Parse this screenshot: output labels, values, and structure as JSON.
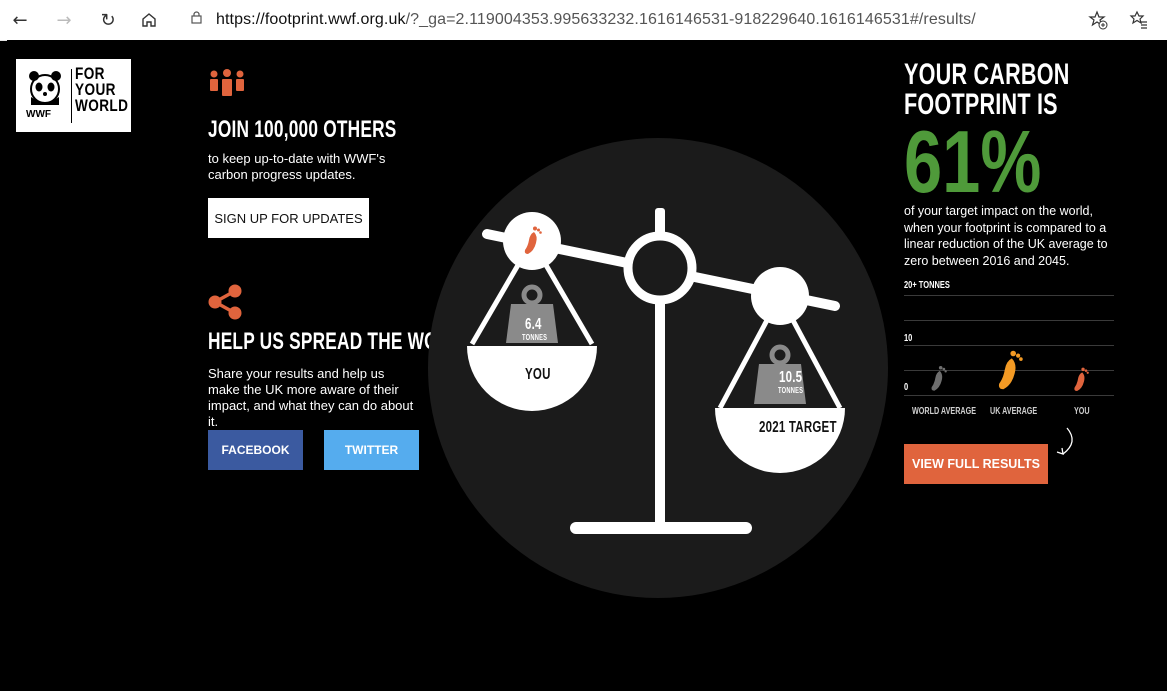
{
  "browser": {
    "url_host": "https://footprint.wwf.org.uk",
    "url_path": "/?_ga=2.119004353.995633232.1616146531-918229640.1616146531#/results/"
  },
  "logo": {
    "line1": "FOR",
    "line2": "YOUR",
    "line3": "WORLD",
    "brand": "WWF"
  },
  "join": {
    "heading": "JOIN 100,000 OTHERS",
    "text": "to keep up-to-date with WWF's carbon progress updates.",
    "button": "SIGN UP FOR UPDATES"
  },
  "share": {
    "heading": "HELP US SPREAD THE WORD",
    "text": "Share your results and help us make the UK more aware of their impact, and what they can do about it.",
    "facebook": "FACEBOOK",
    "twitter": "TWITTER"
  },
  "scale": {
    "you_value": "6.4",
    "you_unit": "TONNES",
    "you_label": "YOU",
    "target_value": "10.5",
    "target_unit": "TONNES",
    "target_label": "2021 TARGET"
  },
  "result": {
    "heading_line1": "YOUR CARBON",
    "heading_line2": "FOOTPRINT IS",
    "percent": "61%",
    "description": "of your target impact on the world, when your footprint is compared to a linear reduction of the UK average to zero between 2016 and 2045.",
    "button": "VIEW FULL RESULTS"
  },
  "chart_data": {
    "type": "bar",
    "categories": [
      "WORLD AVERAGE",
      "UK AVERAGE",
      "YOU"
    ],
    "y_ticks": [
      "20+ TONNES",
      "10",
      "0"
    ],
    "colors": {
      "world": "#6e6e6e",
      "uk": "#f39a24",
      "you": "#e0643d"
    }
  },
  "colors": {
    "accent_orange": "#e0643d",
    "green": "#4f9a3a",
    "facebook": "#3b5aa0",
    "twitter": "#55acee"
  }
}
